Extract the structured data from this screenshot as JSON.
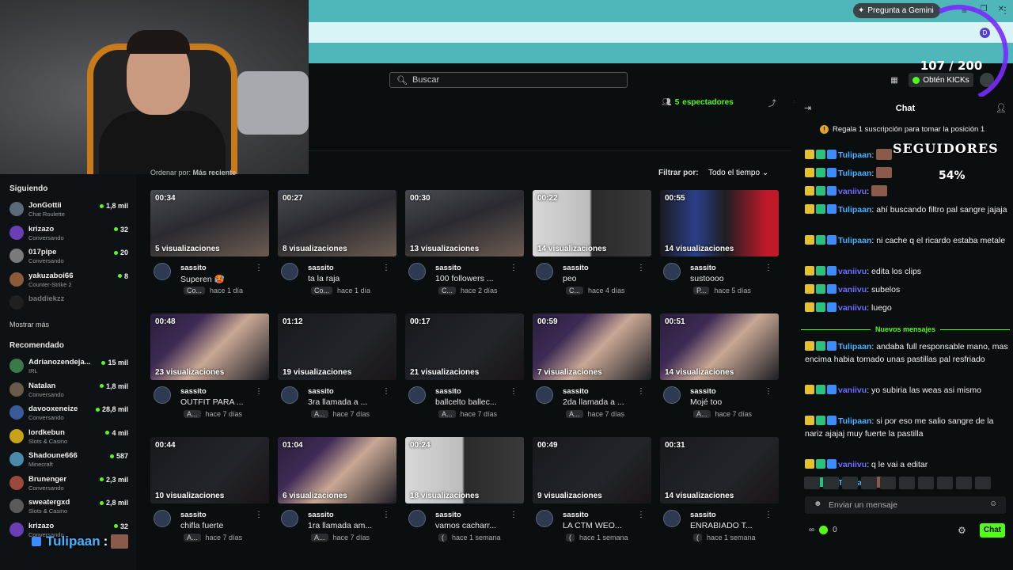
{
  "browser": {
    "gemini_label": "Pregunta a Gemini",
    "profile_letter": "D"
  },
  "overlay": {
    "counter": "107 / 200",
    "followers_label": "SEGUIDORES",
    "followers_percent": "54%",
    "bottom_user": "Tulipaan",
    "bottom_suffix": ":"
  },
  "header": {
    "search_placeholder": "Buscar",
    "kicks_label": "Obtén KICKs",
    "viewers_count": "5",
    "viewers_label": "espectadores"
  },
  "content": {
    "sort_label": "Ordenar por:",
    "sort_value": "Más reciente",
    "filter_label": "Filtrar por:",
    "filter_value": "Todo el tiempo"
  },
  "sidebar": {
    "following_title": "Siguiendo",
    "following": [
      {
        "name": "JonGottii",
        "category": "Chat Roulette",
        "count": "1,8 mil",
        "color": "#5b6a7a"
      },
      {
        "name": "krizazo",
        "category": "Conversando",
        "count": "32",
        "color": "#6a3fb5"
      },
      {
        "name": "017pipe",
        "category": "Conversando",
        "count": "20",
        "color": "#7a7a7a"
      },
      {
        "name": "yakuzaboi66",
        "category": "Counter-Strike 2",
        "count": "8",
        "color": "#8a5a3a"
      },
      {
        "name": "baddiekzz",
        "category": "",
        "count": "",
        "color": "#333333"
      }
    ],
    "show_more": "Mostrar más",
    "recommended_title": "Recomendado",
    "recommended": [
      {
        "name": "Adrianozendeja...",
        "category": "IRL",
        "count": "15 mil",
        "color": "#3a7a4a"
      },
      {
        "name": "Natalan",
        "category": "Conversando",
        "count": "1,8 mil",
        "color": "#6a5a4a"
      },
      {
        "name": "davooxeneize",
        "category": "Conversando",
        "count": "28,8 mil",
        "color": "#3a5a9a"
      },
      {
        "name": "lordkebun",
        "category": "Slots & Casino",
        "count": "4 mil",
        "color": "#c9a21b"
      },
      {
        "name": "Shadoune666",
        "category": "Minecraft",
        "count": "587",
        "color": "#4a8aaa"
      },
      {
        "name": "Brunenger",
        "category": "Conversando",
        "count": "2,3 mil",
        "color": "#9a4a3a"
      },
      {
        "name": "sweatergxd",
        "category": "Slots & Casino",
        "count": "2,8 mil",
        "color": "#5a5a5a"
      },
      {
        "name": "krizazo",
        "category": "Conversando",
        "count": "32",
        "color": "#6a3fb5"
      }
    ]
  },
  "clips": [
    {
      "duration": "00:34",
      "views": "5 visualizaciones",
      "channel": "sassito",
      "title": "Superen 🥵",
      "badge": "Co...",
      "age": "hace 1 día",
      "art": "a"
    },
    {
      "duration": "00:27",
      "views": "8 visualizaciones",
      "channel": "sassito",
      "title": "ta la raja",
      "badge": "Co...",
      "age": "hace 1 día",
      "art": "a"
    },
    {
      "duration": "00:30",
      "views": "13 visualizaciones",
      "channel": "sassito",
      "title": "100 followers ...",
      "badge": "C...",
      "age": "hace 2 días",
      "art": "a"
    },
    {
      "duration": "00:22",
      "views": "14 visualizaciones",
      "channel": "sassito",
      "title": "peo",
      "badge": "C...",
      "age": "hace 4 días",
      "art": "b"
    },
    {
      "duration": "00:55",
      "views": "14 visualizaciones",
      "channel": "sassito",
      "title": "sustoooo",
      "badge": "P...",
      "age": "hace 5 días",
      "art": "c"
    },
    {
      "duration": "00:48",
      "views": "23 visualizaciones",
      "channel": "sassito",
      "title": "OUTFIT PARA ...",
      "badge": "A...",
      "age": "hace 7 días",
      "art": "d"
    },
    {
      "duration": "01:12",
      "views": "19 visualizaciones",
      "channel": "sassito",
      "title": "3ra llamada a ...",
      "badge": "A...",
      "age": "hace 7 días",
      "art": "e"
    },
    {
      "duration": "00:17",
      "views": "21 visualizaciones",
      "channel": "sassito",
      "title": "ballcelto ballec...",
      "badge": "A...",
      "age": "hace 7 días",
      "art": "e"
    },
    {
      "duration": "00:59",
      "views": "7 visualizaciones",
      "channel": "sassito",
      "title": "2da llamada a ...",
      "badge": "A...",
      "age": "hace 7 días",
      "art": "d"
    },
    {
      "duration": "00:51",
      "views": "14 visualizaciones",
      "channel": "sassito",
      "title": "Mojé too",
      "badge": "A...",
      "age": "hace 7 días",
      "art": "d"
    },
    {
      "duration": "00:44",
      "views": "10 visualizaciones",
      "channel": "sassito",
      "title": "chifla fuerte",
      "badge": "A...",
      "age": "hace 7 días",
      "art": "e"
    },
    {
      "duration": "01:04",
      "views": "6 visualizaciones",
      "channel": "sassito",
      "title": "1ra llamada am...",
      "badge": "A...",
      "age": "hace 7 días",
      "art": "d"
    },
    {
      "duration": "00:24",
      "views": "18 visualizaciones",
      "channel": "sassito",
      "title": "vamos cacharr...",
      "badge": "(",
      "age": "hace 1 semana",
      "art": "b"
    },
    {
      "duration": "00:49",
      "views": "9 visualizaciones",
      "channel": "sassito",
      "title": "LA CTM WEO...",
      "badge": "(",
      "age": "hace 1 semana",
      "art": "e"
    },
    {
      "duration": "00:31",
      "views": "14 visualizaciones",
      "channel": "sassito",
      "title": "ENRABIADO T...",
      "badge": "(",
      "age": "hace 1 semana",
      "art": "e"
    }
  ],
  "chat": {
    "title": "Chat",
    "pinned": "Regala 1 suscripción para tomar la posición 1",
    "new_messages_label": "Nuevos mensajes",
    "messages_before": [
      {
        "user": "Tulipaan",
        "kind": "tuli",
        "text": "",
        "emote": true,
        "emoteonly": true
      },
      {
        "user": "Tulipaan",
        "kind": "tuli",
        "text": "",
        "emote": true,
        "emoteonly": true
      },
      {
        "user": "vaniivu",
        "kind": "vani",
        "text": "",
        "emote": true,
        "emoteonly": true
      },
      {
        "user": "Tulipaan",
        "kind": "tuli",
        "text": "ahí buscando filtro pal sangre jajaja"
      },
      {
        "user": "Tulipaan",
        "kind": "tuli",
        "text": "ni cache q el ricardo estaba metale"
      },
      {
        "user": "vaniivu",
        "kind": "vani",
        "text": "edita los clips"
      },
      {
        "user": "vaniivu",
        "kind": "vani",
        "text": "subelos"
      },
      {
        "user": "vaniivu",
        "kind": "vani",
        "text": "luego"
      }
    ],
    "messages_after": [
      {
        "user": "Tulipaan",
        "kind": "tuli",
        "text": "andaba full responsable mano, mas encima habia tomado unas pastillas pal resfriado"
      },
      {
        "user": "vaniivu",
        "kind": "vani",
        "text": "yo subiria las weas asi mismo"
      },
      {
        "user": "Tulipaan",
        "kind": "tuli",
        "text": "si por eso me salio sangre de la nariz ajajaj muy fuerte la pastilla"
      },
      {
        "user": "vaniivu",
        "kind": "vani",
        "text": "q le vai a editar"
      },
      {
        "user": "Tulipaan",
        "kind": "tuli",
        "text": "",
        "emote": true,
        "emoteonly": true
      }
    ],
    "input_placeholder": "Enviar un mensaje",
    "kicks_balance": "0",
    "send_label": "Chat"
  }
}
